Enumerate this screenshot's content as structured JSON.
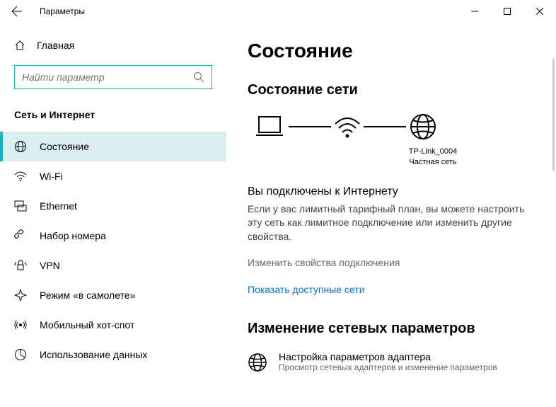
{
  "titlebar": {
    "title": "Параметры"
  },
  "sidebar": {
    "home": "Главная",
    "search_placeholder": "Найти параметр",
    "category": "Сеть и Интернет",
    "items": [
      {
        "label": "Состояние"
      },
      {
        "label": "Wi-Fi"
      },
      {
        "label": "Ethernet"
      },
      {
        "label": "Набор номера"
      },
      {
        "label": "VPN"
      },
      {
        "label": "Режим «в самолете»"
      },
      {
        "label": "Мобильный хот-спот"
      },
      {
        "label": "Использование данных"
      }
    ]
  },
  "main": {
    "heading": "Состояние",
    "status_title": "Состояние сети",
    "network": {
      "name": "TP-Link_0004",
      "type": "Частная сеть"
    },
    "connected_title": "Вы подключены к Интернету",
    "connected_desc": "Если у вас лимитный тарифный план, вы можете настроить эту сеть как лимитное подключение или изменить другие свойства.",
    "link_change": "Изменить свойства подключения",
    "link_show": "Показать доступные сети",
    "change_settings_title": "Изменение сетевых параметров",
    "adapter": {
      "title": "Настройка параметров адаптера",
      "desc": "Просмотр сетевых адаптеров и изменение параметров"
    }
  }
}
